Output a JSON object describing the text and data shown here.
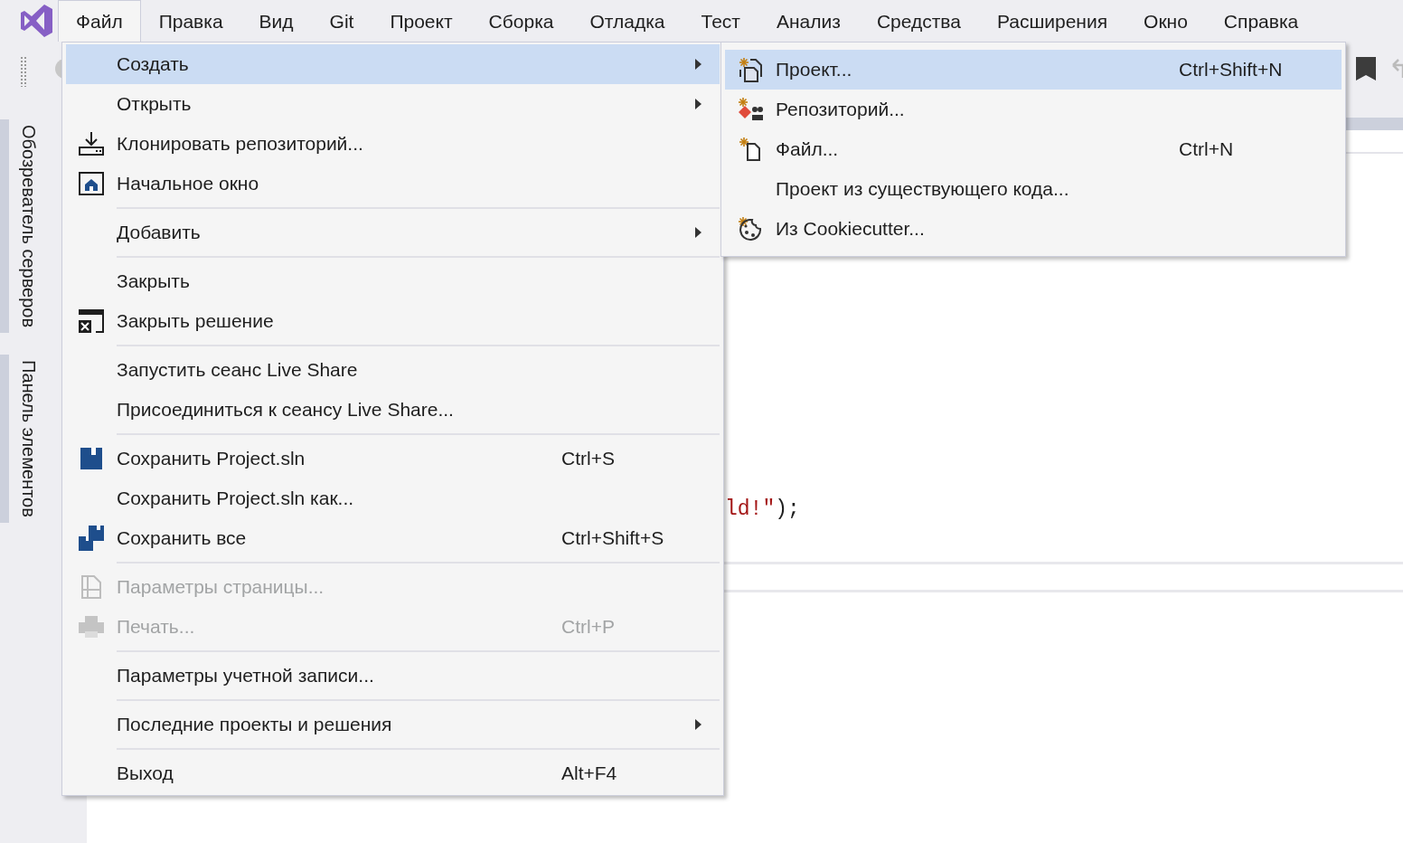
{
  "menu_bar": {
    "items": [
      {
        "label": "Файл",
        "selected": true
      },
      {
        "label": "Правка",
        "selected": false
      },
      {
        "label": "Вид",
        "selected": false
      },
      {
        "label": "Git",
        "selected": false
      },
      {
        "label": "Проект",
        "selected": false
      },
      {
        "label": "Сборка",
        "selected": false
      },
      {
        "label": "Отладка",
        "selected": false
      },
      {
        "label": "Тест",
        "selected": false
      },
      {
        "label": "Анализ",
        "selected": false
      },
      {
        "label": "Средства",
        "selected": false
      },
      {
        "label": "Расширения",
        "selected": false
      },
      {
        "label": "Окно",
        "selected": false
      },
      {
        "label": "Справка",
        "selected": false
      }
    ]
  },
  "side_tabs": [
    {
      "label": "Обозреватель серверов"
    },
    {
      "label": "Панель элементов"
    }
  ],
  "editor": {
    "code_line": {
      "string": "ld!\"",
      "punct": ");"
    }
  },
  "file_menu": {
    "items": [
      {
        "kind": "item",
        "label": "Создать",
        "submenu": true,
        "selected": true,
        "disabled": false
      },
      {
        "kind": "item",
        "label": "Открыть",
        "submenu": true,
        "selected": false,
        "disabled": false
      },
      {
        "kind": "item",
        "label": "Клонировать репозиторий...",
        "submenu": false,
        "selected": false,
        "disabled": false
      },
      {
        "kind": "item",
        "label": "Начальное окно",
        "submenu": false,
        "selected": false,
        "disabled": false
      },
      {
        "kind": "separator"
      },
      {
        "kind": "item",
        "label": "Добавить",
        "submenu": true,
        "selected": false,
        "disabled": false
      },
      {
        "kind": "separator"
      },
      {
        "kind": "item",
        "label": "Закрыть",
        "submenu": false,
        "selected": false,
        "disabled": false
      },
      {
        "kind": "item",
        "label": "Закрыть решение",
        "submenu": false,
        "selected": false,
        "disabled": false
      },
      {
        "kind": "separator"
      },
      {
        "kind": "item",
        "label": "Запустить сеанс Live Share",
        "submenu": false,
        "selected": false,
        "disabled": false
      },
      {
        "kind": "item",
        "label": "Присоединиться к сеансу Live Share...",
        "submenu": false,
        "selected": false,
        "disabled": false
      },
      {
        "kind": "separator"
      },
      {
        "kind": "item",
        "label": "Сохранить Project.sln",
        "shortcut": "Ctrl+S",
        "submenu": false,
        "selected": false,
        "disabled": false
      },
      {
        "kind": "item",
        "label": "Сохранить Project.sln как...",
        "submenu": false,
        "selected": false,
        "disabled": false
      },
      {
        "kind": "item",
        "label": "Сохранить все",
        "shortcut": "Ctrl+Shift+S",
        "submenu": false,
        "selected": false,
        "disabled": false
      },
      {
        "kind": "separator"
      },
      {
        "kind": "item",
        "label": "Параметры страницы...",
        "submenu": false,
        "selected": false,
        "disabled": true
      },
      {
        "kind": "item",
        "label": "Печать...",
        "shortcut": "Ctrl+P",
        "submenu": false,
        "selected": false,
        "disabled": true
      },
      {
        "kind": "separator"
      },
      {
        "kind": "item",
        "label": "Параметры учетной записи...",
        "submenu": false,
        "selected": false,
        "disabled": false
      },
      {
        "kind": "separator"
      },
      {
        "kind": "item",
        "label": "Последние проекты и решения",
        "submenu": true,
        "selected": false,
        "disabled": false
      },
      {
        "kind": "separator"
      },
      {
        "kind": "item",
        "label": "Выход",
        "shortcut": "Alt+F4",
        "submenu": false,
        "selected": false,
        "disabled": false
      }
    ]
  },
  "new_submenu": {
    "items": [
      {
        "kind": "item",
        "label": "Проект...",
        "shortcut": "Ctrl+Shift+N",
        "submenu": false,
        "selected": true,
        "disabled": false
      },
      {
        "kind": "item",
        "label": "Репозиторий...",
        "submenu": false,
        "selected": false,
        "disabled": false
      },
      {
        "kind": "item",
        "label": "Файл...",
        "shortcut": "Ctrl+N",
        "submenu": false,
        "selected": false,
        "disabled": false
      },
      {
        "kind": "item",
        "label": "Проект из существующего кода...",
        "submenu": false,
        "selected": false,
        "disabled": false
      },
      {
        "kind": "item",
        "label": "Из Cookiecutter...",
        "submenu": false,
        "selected": false,
        "disabled": false
      }
    ]
  }
}
